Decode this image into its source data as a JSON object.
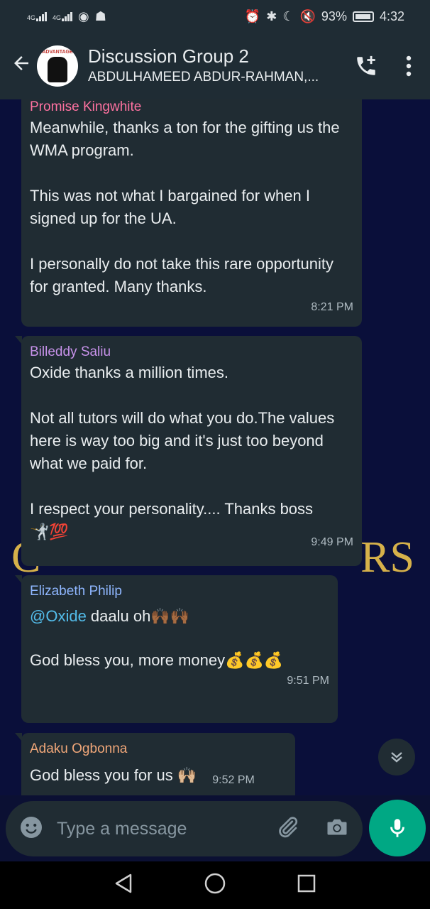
{
  "status_bar": {
    "network_left": "4G",
    "network_right": "4G",
    "battery": "93%",
    "time": "4:32"
  },
  "header": {
    "avatar_brand": "ADVANTAGE",
    "title": "Discussion Group 2",
    "subtitle": "ABDULHAMEED ABDUR-RAHMAN,..."
  },
  "watermark": {
    "left": "C",
    "right": "RS"
  },
  "messages": [
    {
      "sender": "Promise Kingwhite",
      "sender_color": "#ff72a1",
      "text": "Meanwhile, thanks a ton for the gifting us the WMA program.\n\nThis was not what I bargained for when I signed up for the UA.\n\nI personally do not take this rare opportunity for granted. Many thanks.",
      "time": "8:21 PM"
    },
    {
      "sender": "Billeddy Saliu",
      "sender_color": "#c792ea",
      "text": "Oxide thanks a million times.\n\nNot all tutors will do what you do.The values here is way too big and it's just too beyond what we paid for.\n\nI respect your personality.... Thanks boss\n🤺💯",
      "time": "9:49 PM"
    },
    {
      "sender": "Elizabeth Philip",
      "sender_color": "#8fb7ff",
      "mention": "@Oxide",
      "text_after_mention": " daalu oh🙌🏾🙌🏾",
      "text2": "God bless you, more money💰💰💰",
      "time": "9:51 PM"
    },
    {
      "sender": "Adaku Ogbonna",
      "sender_color": "#f0a779",
      "text": "God bless you for us 🙌🏼",
      "time": "9:52 PM"
    }
  ],
  "input": {
    "placeholder": "Type a message"
  },
  "colors": {
    "accent": "#00a884",
    "bubble": "#202c33",
    "header": "#1f2c34"
  }
}
